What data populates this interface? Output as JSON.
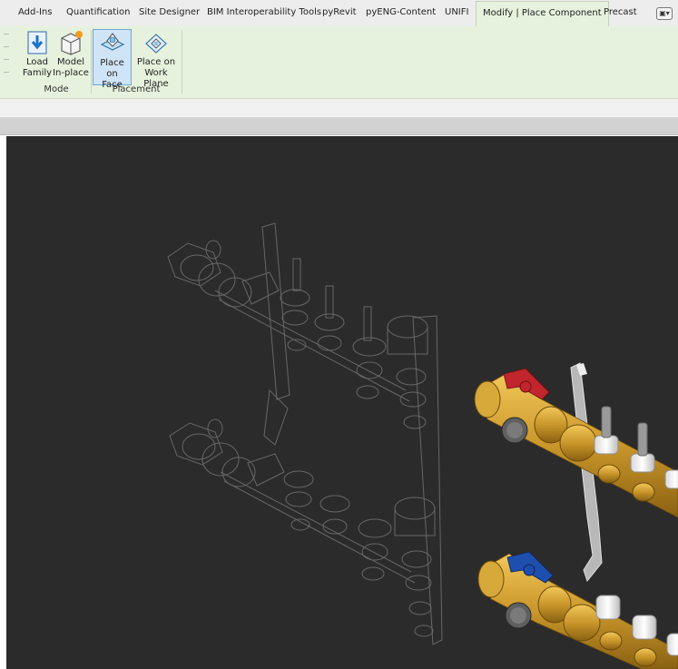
{
  "ribbon_tabs": [
    {
      "label": "Add-Ins"
    },
    {
      "label": "Quantification"
    },
    {
      "label": "Site Designer"
    },
    {
      "label": "BIM Interoperability Tools"
    },
    {
      "label": "pyRevit"
    },
    {
      "label": "pyENG-Content"
    },
    {
      "label": "UNIFI"
    },
    {
      "label": "Modify | Place Component",
      "active": true
    },
    {
      "label": "Precast"
    }
  ],
  "tab_overflow_icon": "dropdown-icon",
  "buttons": {
    "load_family": {
      "label": "Load\nFamily",
      "icon": "load-family-icon"
    },
    "model_inplace": {
      "label": "Model\nIn-place",
      "icon": "model-inplace-icon"
    },
    "place_on_face": {
      "label": "Place on\nFace",
      "icon": "place-on-face-icon",
      "selected": true
    },
    "place_on_workplane": {
      "label": "Place on\nWork Plane",
      "icon": "place-on-workplane-icon"
    }
  },
  "panels": {
    "mode": "Mode",
    "placement": "Placement"
  },
  "colors": {
    "ribbon_bg": "#e6f2dd",
    "canvas_bg": "#2b2b2b",
    "brass": "#c9962a",
    "red_handle": "#c0262b",
    "blue_handle": "#1e4fae",
    "selected_button": "#cfe4f6"
  },
  "viewport": {
    "content": "3D view of two pipe manifold assemblies: ghosted wireframe and rendered brass manifolds with red and blue valve handles"
  }
}
